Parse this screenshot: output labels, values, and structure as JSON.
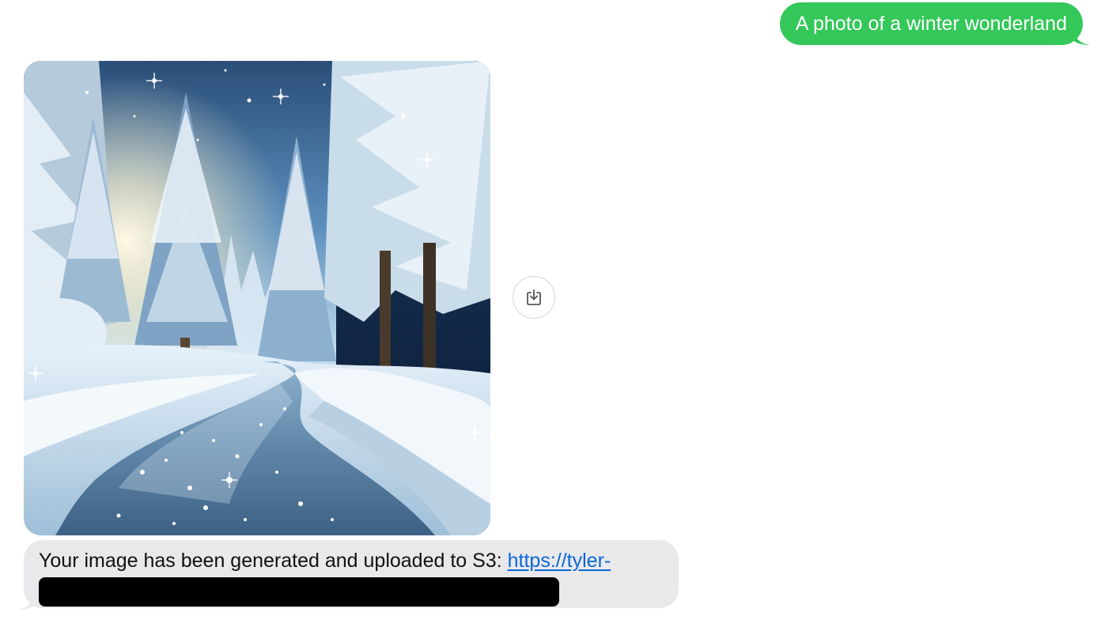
{
  "conversation": {
    "outgoing_message": {
      "text": "A photo of a winter wonderland",
      "bubble_color": "#34c759"
    },
    "image_message": {
      "alt": "A photo of a winter wonderland",
      "save_button_icon": "save-to-downloads-icon"
    },
    "incoming_message": {
      "text": "Your image has been generated and uploaded to S3:",
      "link_text": "https://tyler-",
      "link_color": "#0a66d8",
      "bubble_color": "#e9e9eb"
    }
  }
}
